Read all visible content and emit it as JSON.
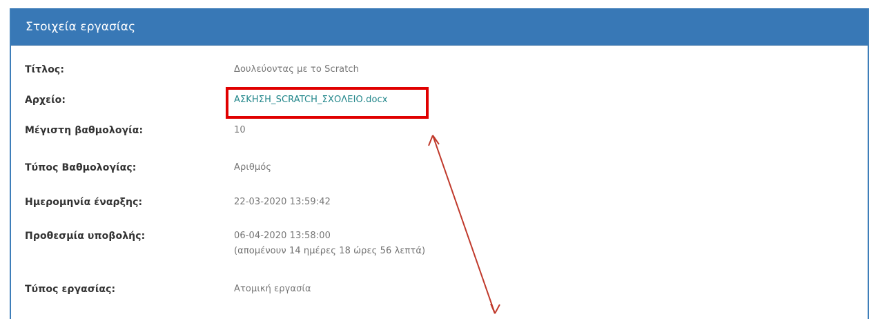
{
  "panel": {
    "title": "Στοιχεία εργασίας"
  },
  "details": {
    "title_label": "Τίτλος:",
    "title_value": "Δουλεύοντας με το Scratch",
    "file_label": "Αρχείο:",
    "file_value": "ΑΣΚΗΣΗ_SCRATCH_ΣΧΟΛΕΙΟ.docx",
    "max_grade_label": "Μέγιστη βαθμολογία:",
    "max_grade_value": "10",
    "grade_type_label": "Τύπος Βαθμολογίας:",
    "grade_type_value": "Αριθμός",
    "start_date_label": "Ημερομηνία έναρξης:",
    "start_date_value": "22-03-2020 13:59:42",
    "deadline_label": "Προθεσμία υποβολής:",
    "deadline_value": "06-04-2020 13:58:00",
    "deadline_remaining": "(απομένουν 14 ημέρες 18 ώρες 56 λεπτά)",
    "assignment_type_label": "Τύπος εργασίας:",
    "assignment_type_value": "Ατομική εργασία"
  },
  "colors": {
    "header": "#3878b6",
    "link": "#21868a",
    "highlight": "#e00000",
    "arrow": "#c0392b"
  }
}
